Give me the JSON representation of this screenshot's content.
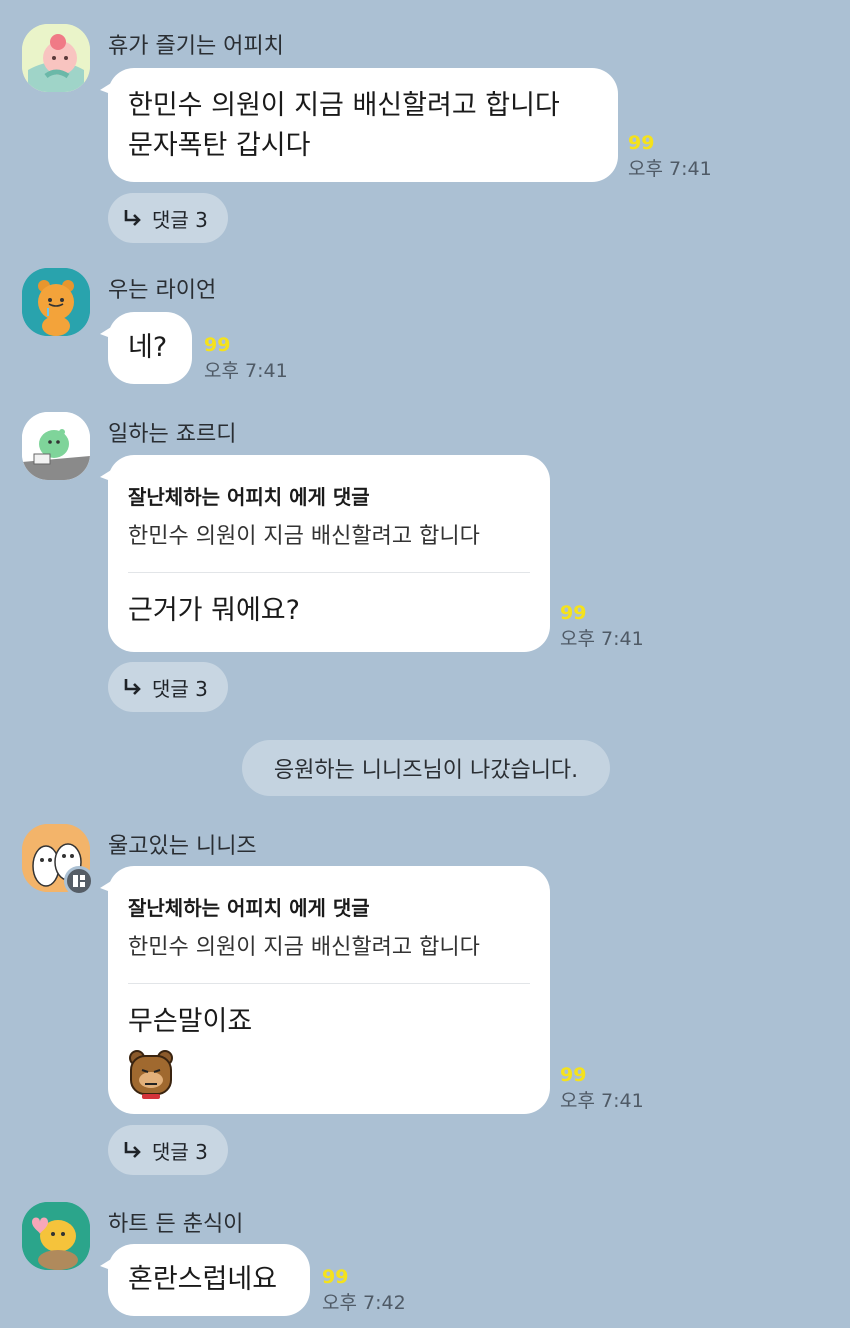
{
  "messages": [
    {
      "sender": "휴가 즐기는 어피치",
      "lines": [
        "한민수 의원이 지금 배신할려고 합니다",
        "문자폭탄 갑시다"
      ],
      "count": "99",
      "time": "오후 7:41",
      "reply_label": "댓글 3"
    },
    {
      "sender": "우는 라이언",
      "lines": [
        "네?"
      ],
      "count": "99",
      "time": "오후 7:41"
    },
    {
      "sender": "일하는 죠르디",
      "quote_name": "잘난체하는 어피치 에게 댓글",
      "quote_text": "한민수 의원이 지금 배신할려고 합니다",
      "lines": [
        "근거가 뭐에요?"
      ],
      "count": "99",
      "time": "오후 7:41",
      "reply_label": "댓글 3"
    },
    {
      "sender": "울고있는 니니즈",
      "quote_name": "잘난체하는 어피치 에게 댓글",
      "quote_text": "한민수 의원이 지금 배신할려고 합니다",
      "lines": [
        "무슨말이죠"
      ],
      "count": "99",
      "time": "오후 7:41",
      "reply_label": "댓글 3"
    },
    {
      "sender": "하트 든 춘식이",
      "lines": [
        "혼란스럽네요"
      ],
      "count": "99",
      "time": "오후 7:42"
    }
  ],
  "system_notice": "응원하는 니니즈님이 나갔습니다.",
  "icons": {
    "reply": "reply-arrow-icon",
    "avatar_badge": "profile-badge-icon",
    "sticker": "bear-sticker-icon"
  },
  "colors": {
    "background": "#abc0d3",
    "bubble": "#ffffff",
    "count": "#f5e21c"
  }
}
